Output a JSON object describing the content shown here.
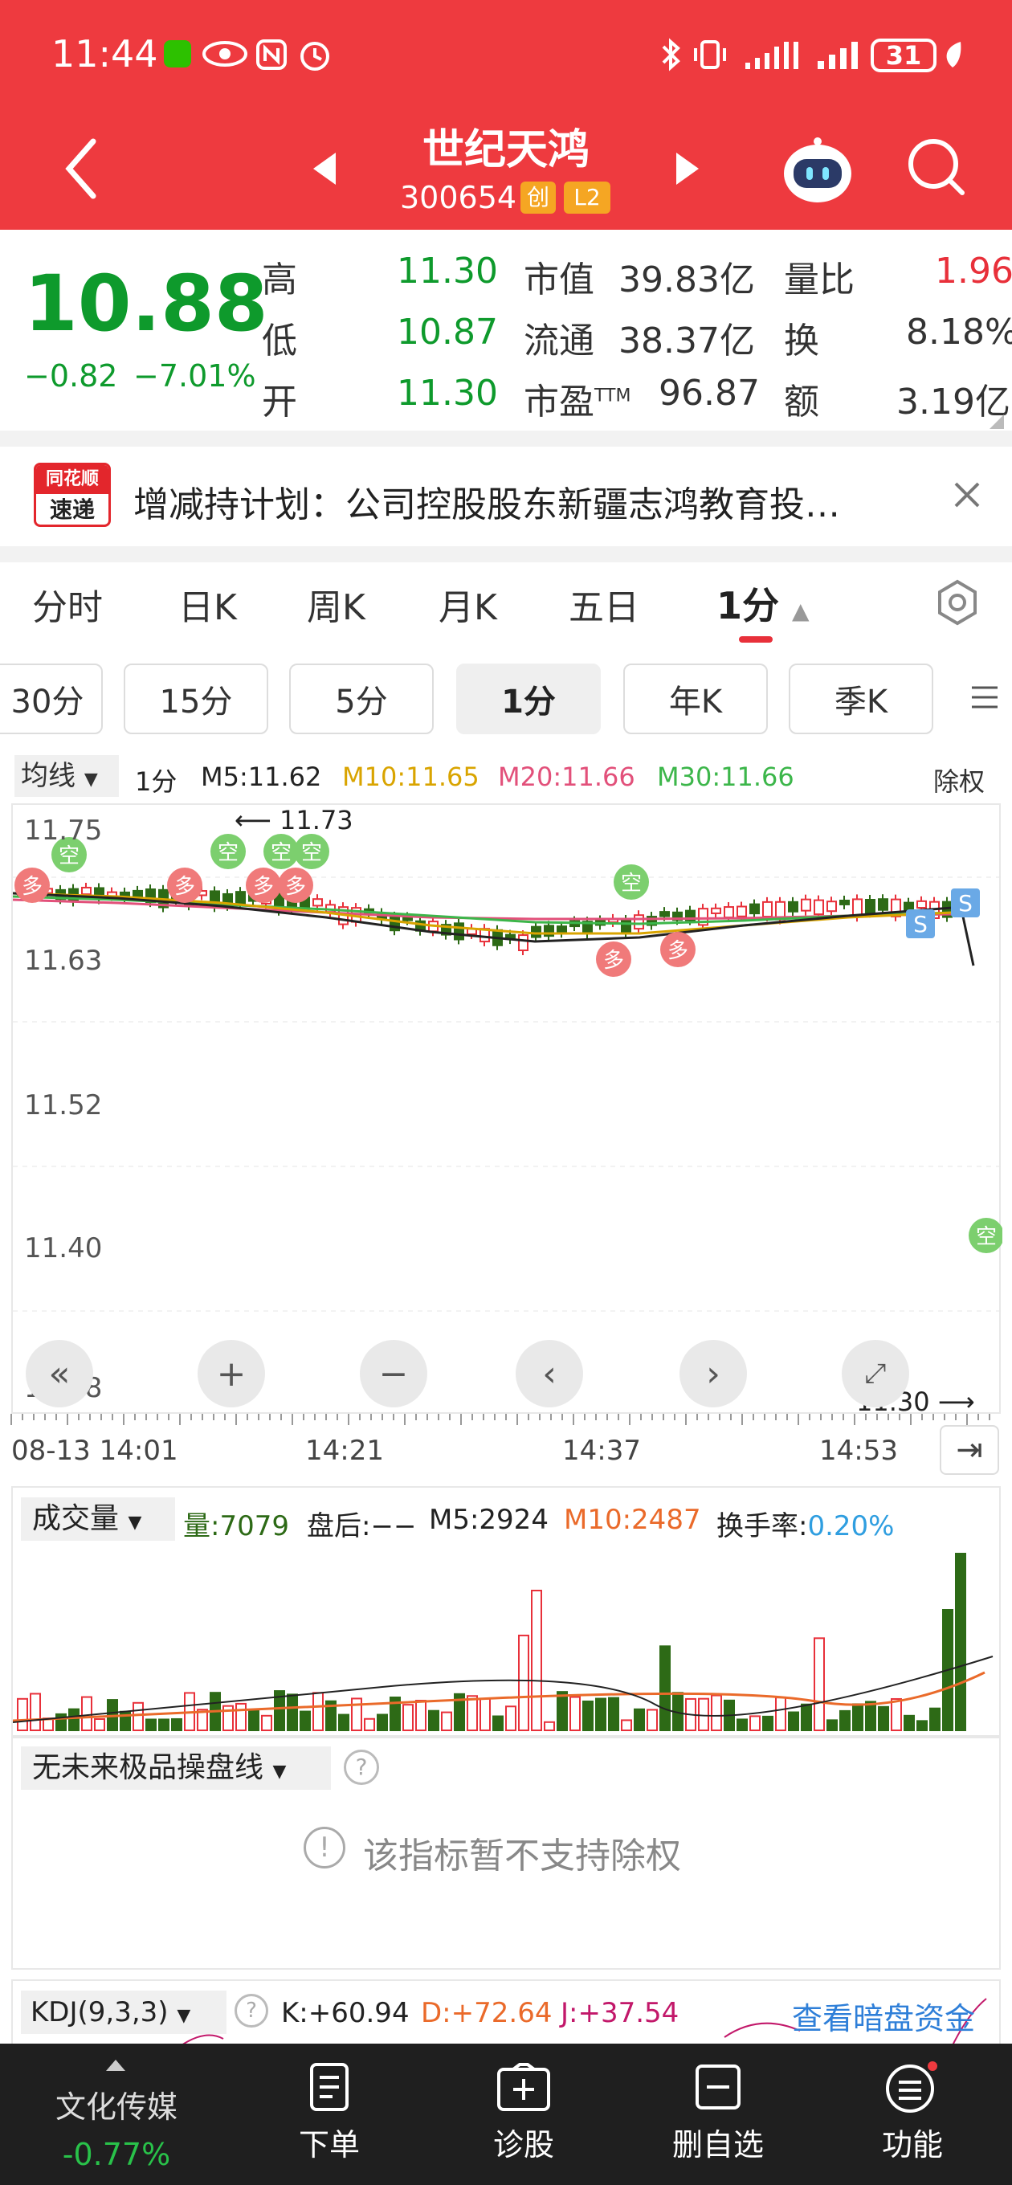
{
  "status_bar": {
    "time": "11:44",
    "battery": "31",
    "icons": [
      "wechat-icon",
      "eye-icon",
      "nfc-icon",
      "alarm-icon",
      "bluetooth-icon",
      "vibrate-icon",
      "signal-icon",
      "signal-icon",
      "battery-icon",
      "leaf-icon"
    ]
  },
  "header": {
    "stock_name": "世纪天鸿",
    "stock_code": "300654",
    "badge_chuang": "创",
    "badge_l2": "L2"
  },
  "quote": {
    "price": "10.88",
    "change": "−0.82",
    "change_pct": "−7.01%",
    "high_label": "高",
    "high": "11.30",
    "low_label": "低",
    "low": "10.87",
    "open_label": "开",
    "open": "11.30",
    "mktcap_label": "市值",
    "mktcap": "39.83亿",
    "float_label": "流通",
    "float": "38.37亿",
    "pe_label": "市盈",
    "pe_sup": "TTM",
    "pe": "96.87",
    "vol_ratio_label": "量比",
    "vol_ratio": "1.96",
    "turnover_label": "换",
    "turnover": "8.18%",
    "amount_label": "额",
    "amount": "3.19亿",
    "colors": {
      "down": "#0e9a2c",
      "up": "#e8303a"
    }
  },
  "news": {
    "logo_top": "同花顺",
    "logo_bottom": "速递",
    "text": "增减持计划：公司控股股东新疆志鸿教育投…"
  },
  "tabs": [
    {
      "label": "分时"
    },
    {
      "label": "日K"
    },
    {
      "label": "周K"
    },
    {
      "label": "月K"
    },
    {
      "label": "五日"
    },
    {
      "label": "1分"
    }
  ],
  "subtabs": [
    {
      "label": "30分"
    },
    {
      "label": "15分"
    },
    {
      "label": "5分"
    },
    {
      "label": "1分"
    },
    {
      "label": "年K"
    },
    {
      "label": "季K"
    }
  ],
  "legend": {
    "ma_select": "均线",
    "period": "1分",
    "m5": "M5:11.62",
    "m10": "M10:11.65",
    "m20": "M20:11.66",
    "m30": "M30:11.66",
    "exright": "除权"
  },
  "chart": {
    "y_labels": [
      "11.75",
      "11.63",
      "11.52",
      "11.40",
      "11.28"
    ],
    "high_marker": "11.73",
    "low_marker": "11.30",
    "x_labels": [
      "08-13 14:01",
      "14:21",
      "14:37",
      "14:53"
    ],
    "tag_duo": "多",
    "tag_kong": "空",
    "tag_s": "S"
  },
  "chart_data": {
    "type": "candlestick",
    "title": "",
    "ylim": [
      11.28,
      11.75
    ],
    "x_ticks": [
      "08-13 14:01",
      "14:21",
      "14:37",
      "14:53"
    ],
    "series": [
      {
        "name": "M5",
        "last": 11.62
      },
      {
        "name": "M10",
        "last": 11.65
      },
      {
        "name": "M20",
        "last": 11.66
      },
      {
        "name": "M30",
        "last": 11.66
      }
    ],
    "annotations": [
      "11.73",
      "11.30"
    ]
  },
  "volume": {
    "select": "成交量",
    "vol": "量:7079",
    "after": "盘后:−−",
    "m5": "M5:2924",
    "m10": "M10:2487",
    "turn_label": "换手率:",
    "turn": "0.20%"
  },
  "indicator": {
    "select": "无未来极品操盘线",
    "notice": "该指标暂不支持除权"
  },
  "kdj": {
    "select": "KDJ(9,3,3)",
    "k": "K:+60.94",
    "d": "D:+72.64",
    "j": "J:+37.54",
    "link": "查看暗盘资金"
  },
  "bottom": {
    "sector": "文化传媒",
    "sector_pct": "-0.77%",
    "order": "下单",
    "diagnose": "诊股",
    "remove": "删自选",
    "func": "功能"
  }
}
